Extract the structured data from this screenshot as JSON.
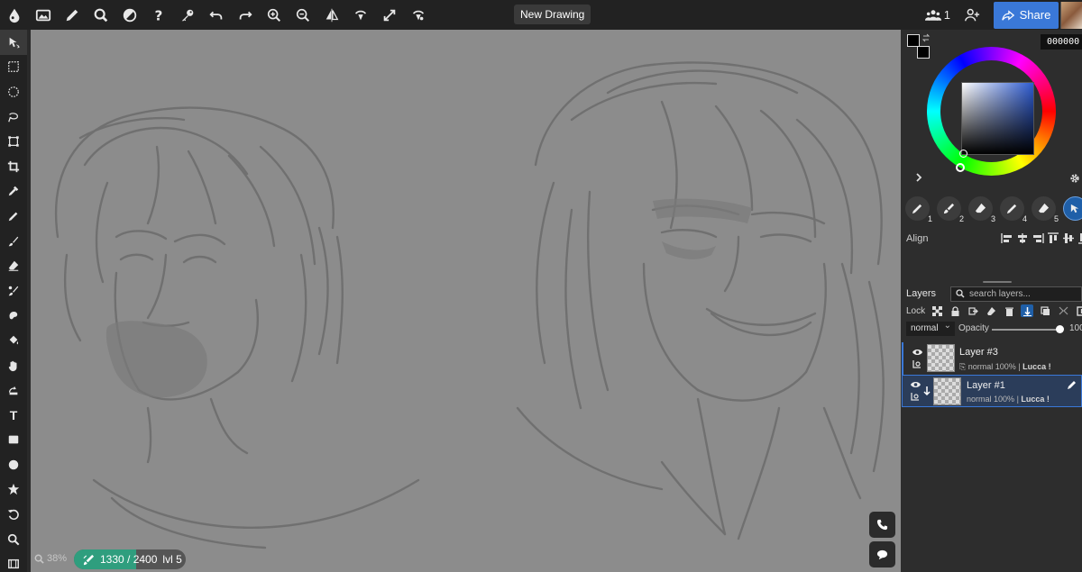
{
  "toolbar": {
    "doc_title": "New Drawing",
    "user_count": "1",
    "share_label": "Share"
  },
  "status": {
    "zoom": "38%",
    "progress_text": "1330 / 2400",
    "level": "lvl 5",
    "progress_current": 1330,
    "progress_max": 2400
  },
  "colors": {
    "accent": "#3a78d8",
    "canvas": "#8c8c8c",
    "progress": "#2f9e7e",
    "current": "#000000"
  },
  "color_panel": {
    "hex": "000000"
  },
  "brushes": [
    {
      "num": "1",
      "icon": "pen-icon"
    },
    {
      "num": "2",
      "icon": "brush-icon"
    },
    {
      "num": "3",
      "icon": "eraser-icon"
    },
    {
      "num": "4",
      "icon": "pen-icon"
    },
    {
      "num": "5",
      "icon": "eraser-icon"
    },
    {
      "num": "",
      "icon": "select-arrow-icon"
    }
  ],
  "align": {
    "label": "Align"
  },
  "layers_panel": {
    "title": "Layers",
    "search_placeholder": "search layers...",
    "lock_label": "Lock",
    "blend_mode": "normal",
    "opacity_label": "Opacity",
    "opacity_value": "100"
  },
  "layers": [
    {
      "name": "Layer #3",
      "blend": "normal",
      "opacity": "100%",
      "owner": "Lucca !"
    },
    {
      "name": "Layer #1",
      "blend": "normal",
      "opacity": "100%",
      "owner": "Lucca !"
    }
  ]
}
